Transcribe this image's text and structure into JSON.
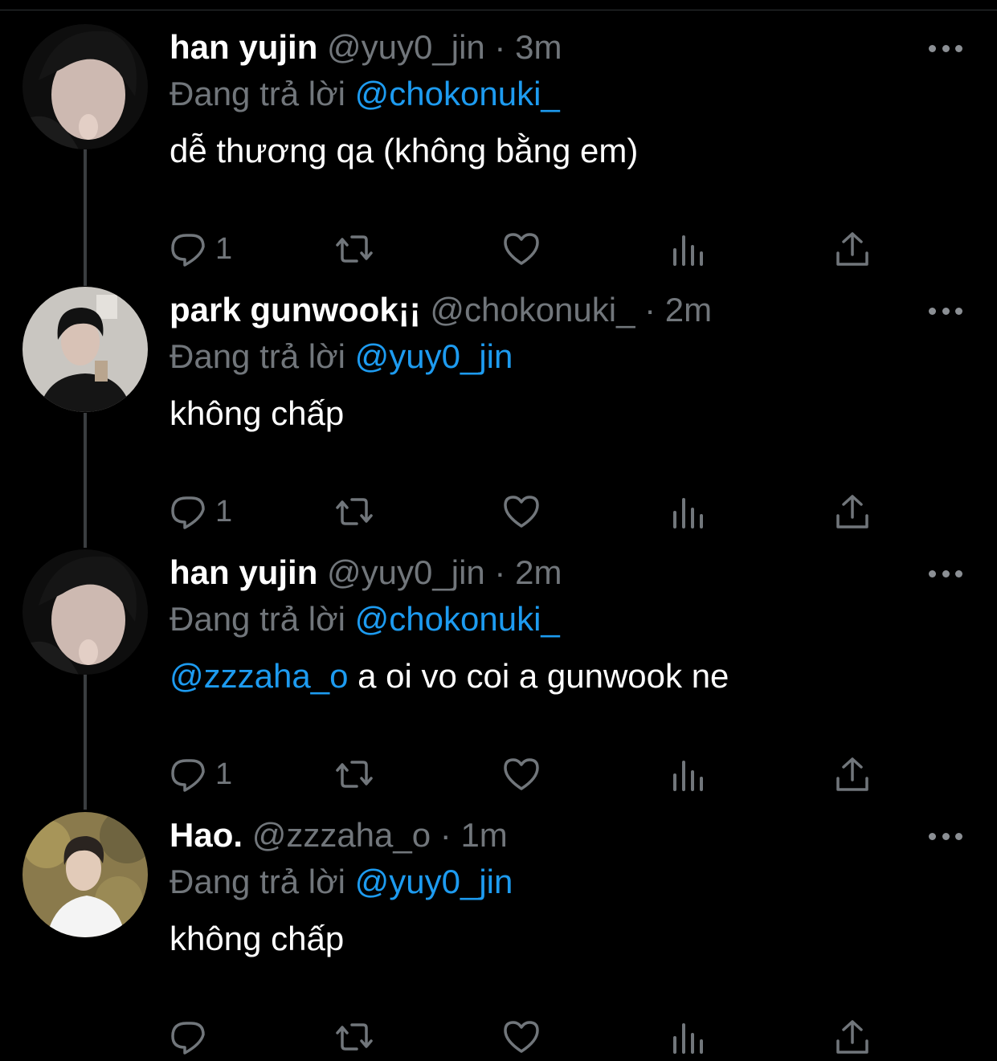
{
  "colors": {
    "background": "#000000",
    "text": "#ffffff",
    "muted": "#71767b",
    "link": "#1d9bf0",
    "thread_line": "#3a3d40"
  },
  "icons": {
    "reply": "reply-bubble-icon",
    "retweet": "retweet-icon",
    "like": "heart-icon",
    "views": "views-bar-icon",
    "share": "share-upload-icon",
    "more": "more-dots-icon"
  },
  "tweets": [
    {
      "name": "han yujin",
      "handle": "@yuy0_jin",
      "sep": " · ",
      "time": "3m",
      "replying_label": "Đang trả lời ",
      "replying_to": "@chokonuki_",
      "text_mention": "",
      "text": "dễ thương qa (không bằng em)",
      "reply_count": "1"
    },
    {
      "name": "park gunwook¡¡",
      "handle": "@chokonuki_",
      "sep": " · ",
      "time": "2m",
      "replying_label": "Đang trả lời ",
      "replying_to": "@yuy0_jin",
      "text_mention": "",
      "text": "không chấp",
      "reply_count": "1"
    },
    {
      "name": "han yujin",
      "handle": "@yuy0_jin",
      "sep": " · ",
      "time": "2m",
      "replying_label": "Đang trả lời ",
      "replying_to": "@chokonuki_",
      "text_mention": "@zzzaha_o",
      "text": " a oi vo coi a gunwook ne",
      "reply_count": "1"
    },
    {
      "name": "Hao.",
      "handle": "@zzzaha_o",
      "sep": " · ",
      "time": "1m",
      "replying_label": "Đang trả lời ",
      "replying_to": "@yuy0_jin",
      "text_mention": "",
      "text": "không chấp",
      "reply_count": ""
    }
  ]
}
